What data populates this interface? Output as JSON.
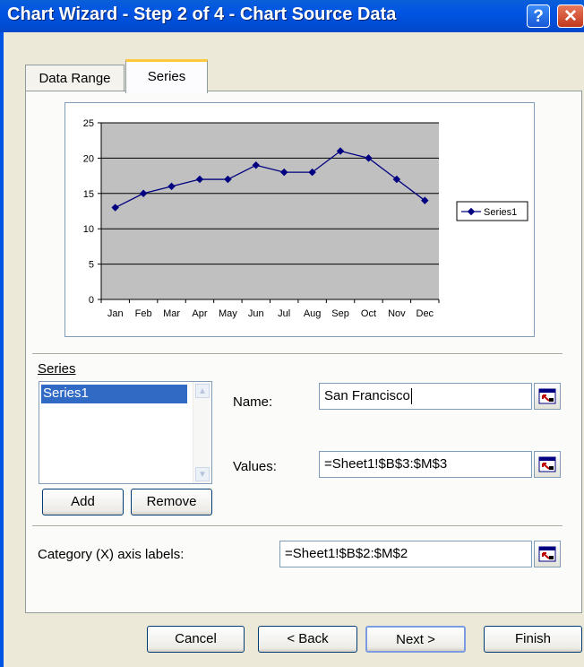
{
  "window": {
    "title": "Chart Wizard - Step 2 of 4 - Chart Source Data",
    "help_label": "?",
    "close_label": "✕"
  },
  "tabs": [
    {
      "label": "Data Range",
      "active": false
    },
    {
      "label": "Series",
      "active": true
    }
  ],
  "chart_data": {
    "type": "line",
    "categories": [
      "Jan",
      "Feb",
      "Mar",
      "Apr",
      "May",
      "Jun",
      "Jul",
      "Aug",
      "Sep",
      "Oct",
      "Nov",
      "Dec"
    ],
    "series": [
      {
        "name": "Series1",
        "values": [
          13,
          15,
          16,
          17,
          17,
          19,
          18,
          18,
          21,
          20,
          17,
          14
        ],
        "color": "#000080"
      }
    ],
    "y_ticks": [
      0,
      5,
      10,
      15,
      20,
      25
    ],
    "ylim": [
      0,
      25
    ],
    "plot_background": "#c0c0c0",
    "grid": true,
    "legend_position": "right"
  },
  "series_section": {
    "label": "Series",
    "items": [
      "Series1"
    ],
    "selected_index": 0,
    "add_label": "Add",
    "remove_label": "Remove"
  },
  "name_field": {
    "label": "Name:",
    "value": "San Francisco"
  },
  "values_field": {
    "label": "Values:",
    "value": "=Sheet1!$B$3:$M$3"
  },
  "category_field": {
    "label": "Category (X) axis labels:",
    "value": "=Sheet1!$B$2:$M$2"
  },
  "buttons": {
    "cancel": "Cancel",
    "back": "< Back",
    "next": "Next >",
    "finish": "Finish"
  }
}
